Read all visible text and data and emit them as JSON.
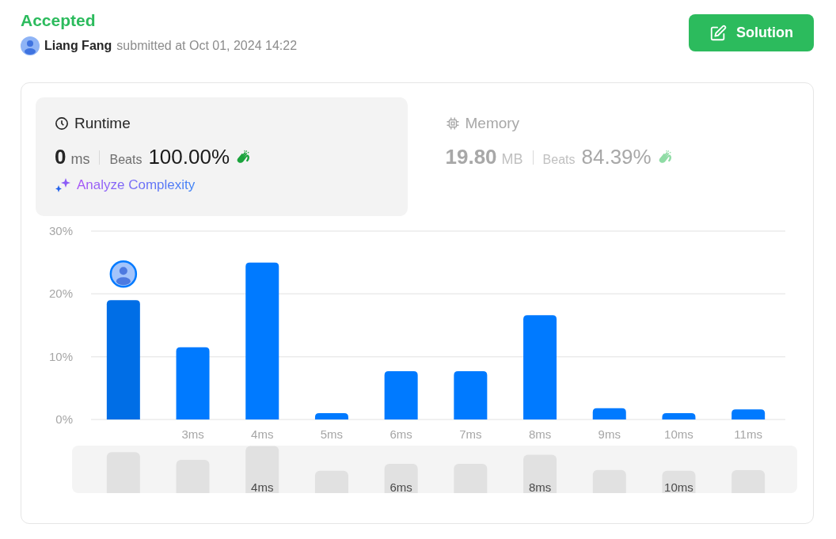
{
  "status": "Accepted",
  "submission": {
    "user": "Liang Fang",
    "submitted_text": "submitted at Oct 01, 2024 14:22"
  },
  "solution_button": "Solution",
  "metrics": [
    {
      "kind": "runtime",
      "title": "Runtime",
      "selected": true,
      "value": "0",
      "unit": "ms",
      "beats_label": "Beats",
      "beats": "100.00%",
      "link": "Analyze Complexity"
    },
    {
      "kind": "memory",
      "title": "Memory",
      "selected": false,
      "value": "19.80",
      "unit": "MB",
      "beats_label": "Beats",
      "beats": "84.39%"
    }
  ],
  "runtime_chart": {
    "bars": [
      {
        "selected": true
      },
      {
        "selected": false
      },
      {
        "selected": false,
        "overview_label": "4ms"
      },
      {
        "selected": false
      },
      {
        "selected": false,
        "overview_label": "6ms"
      },
      {
        "selected": false
      },
      {
        "selected": false,
        "overview_label": "8ms"
      },
      {
        "selected": false
      },
      {
        "selected": false,
        "overview_label": "10ms"
      },
      {
        "selected": false
      }
    ],
    "chart_data": {
      "type": "bar",
      "categories": [
        null,
        "3ms",
        "4ms",
        "5ms",
        "6ms",
        "7ms",
        "8ms",
        "9ms",
        "10ms",
        "11ms"
      ],
      "series": [
        {
          "color": "#007aff",
          "values": [
            19,
            11.5,
            25,
            1,
            7.7,
            7.7,
            16.6,
            1.8,
            1,
            1.6
          ]
        }
      ],
      "ylim": [
        0,
        30
      ],
      "yticks": [
        {
          "value": 0,
          "label": "0%"
        },
        {
          "value": 10,
          "label": "10%"
        },
        {
          "value": 20,
          "label": "20%"
        },
        {
          "value": 30,
          "label": "30%"
        }
      ]
    }
  }
}
